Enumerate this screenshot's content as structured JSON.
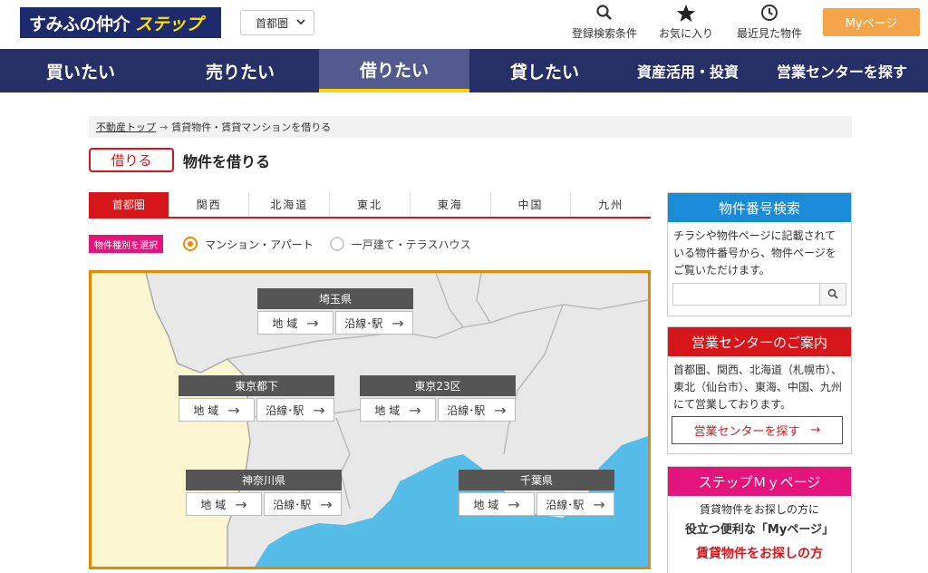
{
  "header": {
    "logo_main": "すみふの仲介",
    "logo_sub": "ステップ",
    "region_value": "首都圏",
    "links": [
      {
        "label": "登録検索条件",
        "icon": "search-icon"
      },
      {
        "label": "お気に入り",
        "icon": "star-icon"
      },
      {
        "label": "最近見た物件",
        "icon": "clock-icon"
      }
    ],
    "mypage_label": "Myページ"
  },
  "nav": {
    "items": [
      {
        "label": "買いたい"
      },
      {
        "label": "売りたい"
      },
      {
        "label": "借りたい"
      },
      {
        "label": "貸したい"
      },
      {
        "label": "資産活用・投資"
      },
      {
        "label": "営業センターを探す"
      }
    ],
    "active": "借りたい"
  },
  "breadcrumb": {
    "top": "不動産トップ",
    "separator": "→",
    "current": "賃貸物件・賃貸マンションを借りる"
  },
  "page": {
    "badge": "借りる",
    "title": "物件を借りる"
  },
  "area_tabs": {
    "items": [
      "首都圏",
      "関西",
      "北海道",
      "東北",
      "東海",
      "中国",
      "九州"
    ],
    "active": "首都圏"
  },
  "property_type": {
    "label": "物件種別を選択",
    "options": [
      {
        "label": "マンション・アパート",
        "selected": true
      },
      {
        "label": "一戸建て・テラスハウス",
        "selected": false
      }
    ]
  },
  "map": {
    "area_button": "地 域",
    "line_button": "沿線･駅",
    "prefectures": [
      {
        "name": "埼玉県"
      },
      {
        "name": "東京都下"
      },
      {
        "name": "東京23区"
      },
      {
        "name": "神奈川県"
      },
      {
        "name": "千葉県"
      }
    ]
  },
  "sidebar": {
    "number_search": {
      "title": "物件番号検索",
      "text": "チラシや物件ページに記載されている物件番号から、物件ページをご覧いただけます。",
      "placeholder": ""
    },
    "center": {
      "title": "営業センターのご案内",
      "text": "首都圏、関西、北海道（札幌市）、東北（仙台市）、東海、中国、九州にて営業しております。",
      "button": "営業センターを探す"
    },
    "mypage": {
      "title": "ステップＭｙページ",
      "line1": "賃貸物件をお探しの方に",
      "line2": "役立つ便利な「Myページ」",
      "line3": "賃貸物件をお探しの方"
    }
  },
  "colors": {
    "nav_bg": "#262f66",
    "nav_active": "#535a8e",
    "accent_red": "#d7161b",
    "accent_pink": "#e3157c",
    "accent_blue": "#1a8bd6",
    "accent_orange": "#f4a54a",
    "map_border": "#e08a00",
    "sea": "#56bde8"
  }
}
